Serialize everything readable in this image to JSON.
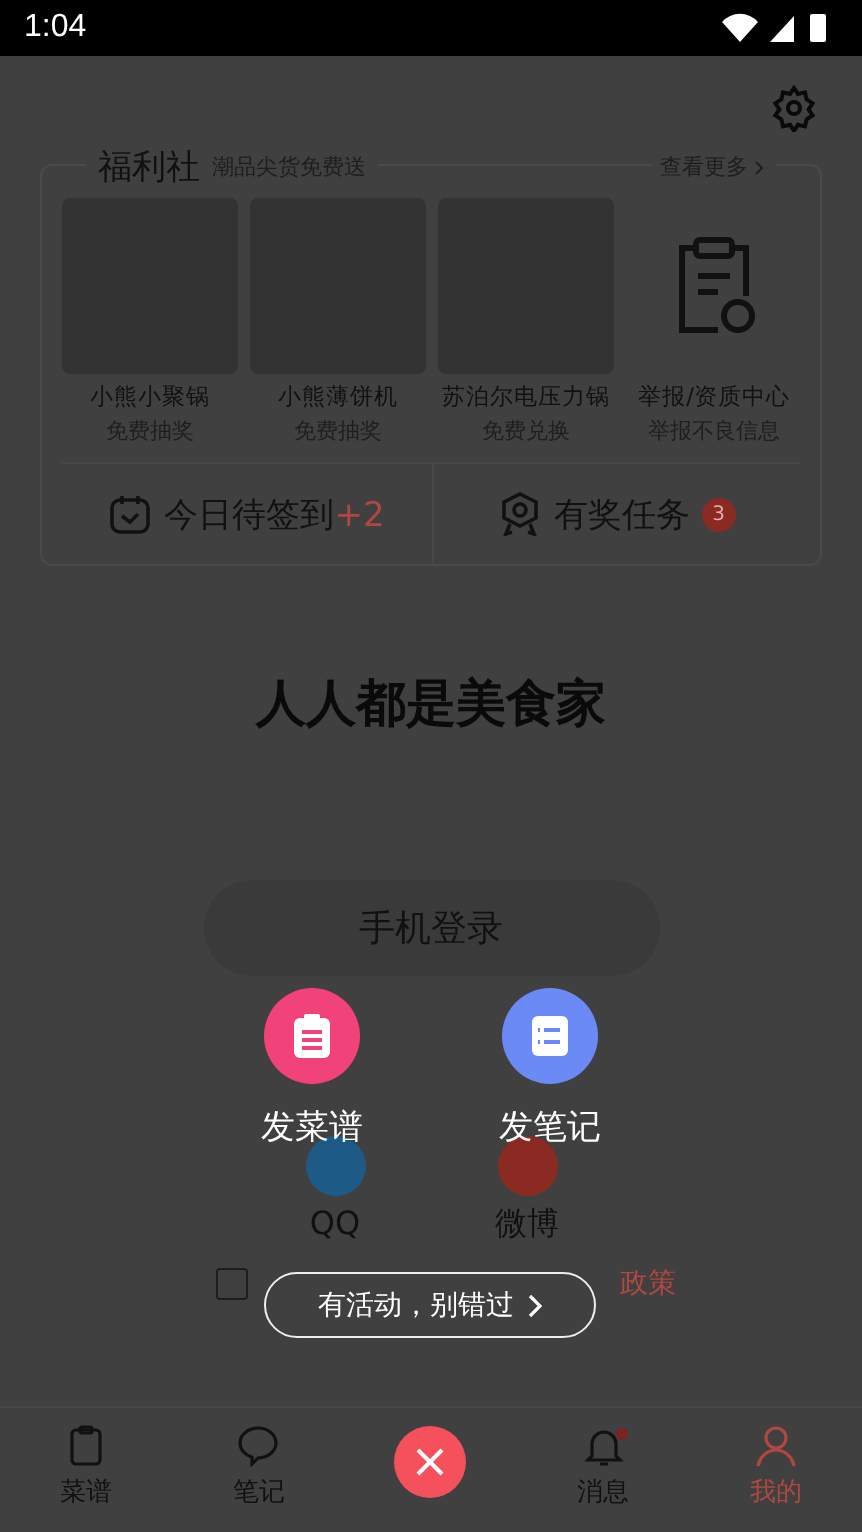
{
  "status_bar": {
    "time": "1:04"
  },
  "welfare": {
    "title": "福利社",
    "subtitle": "潮品尖货免费送",
    "more": "查看更多",
    "items": [
      {
        "kind": "placeholder",
        "name": "小熊小聚锅",
        "action": "免费抽奖"
      },
      {
        "kind": "placeholder",
        "name": "小熊薄饼机",
        "action": "免费抽奖"
      },
      {
        "kind": "placeholder",
        "name": "苏泊尔电压力锅",
        "action": "免费兑换"
      },
      {
        "kind": "icon",
        "name": "举报/资质中心",
        "action": "举报不良信息"
      }
    ],
    "checkin": {
      "label": "今日待签到",
      "bonus": "+2"
    },
    "tasks": {
      "label": "有奖任务",
      "badge": "3"
    }
  },
  "headline": "人人都是美食家",
  "login_button": "手机登录",
  "social": [
    {
      "label": "QQ",
      "color": "#1d5a86"
    },
    {
      "label": "微博",
      "color": "#8a2a22"
    }
  ],
  "agreement": {
    "checked": false,
    "visible_text": "政策"
  },
  "nav": [
    {
      "kind": "tab",
      "label": "菜谱",
      "selected": false,
      "dot": false
    },
    {
      "kind": "tab",
      "label": "笔记",
      "selected": false,
      "dot": false
    },
    {
      "kind": "center"
    },
    {
      "kind": "tab",
      "label": "消息",
      "selected": false,
      "dot": true
    },
    {
      "kind": "tab",
      "label": "我的",
      "selected": true,
      "dot": false
    }
  ],
  "popup": {
    "actions": [
      {
        "kind": "recipe",
        "label": "发菜谱",
        "color": "#f2427a"
      },
      {
        "kind": "note",
        "label": "发笔记",
        "color": "#6b8af6"
      }
    ],
    "promo": "有活动，别错过"
  }
}
